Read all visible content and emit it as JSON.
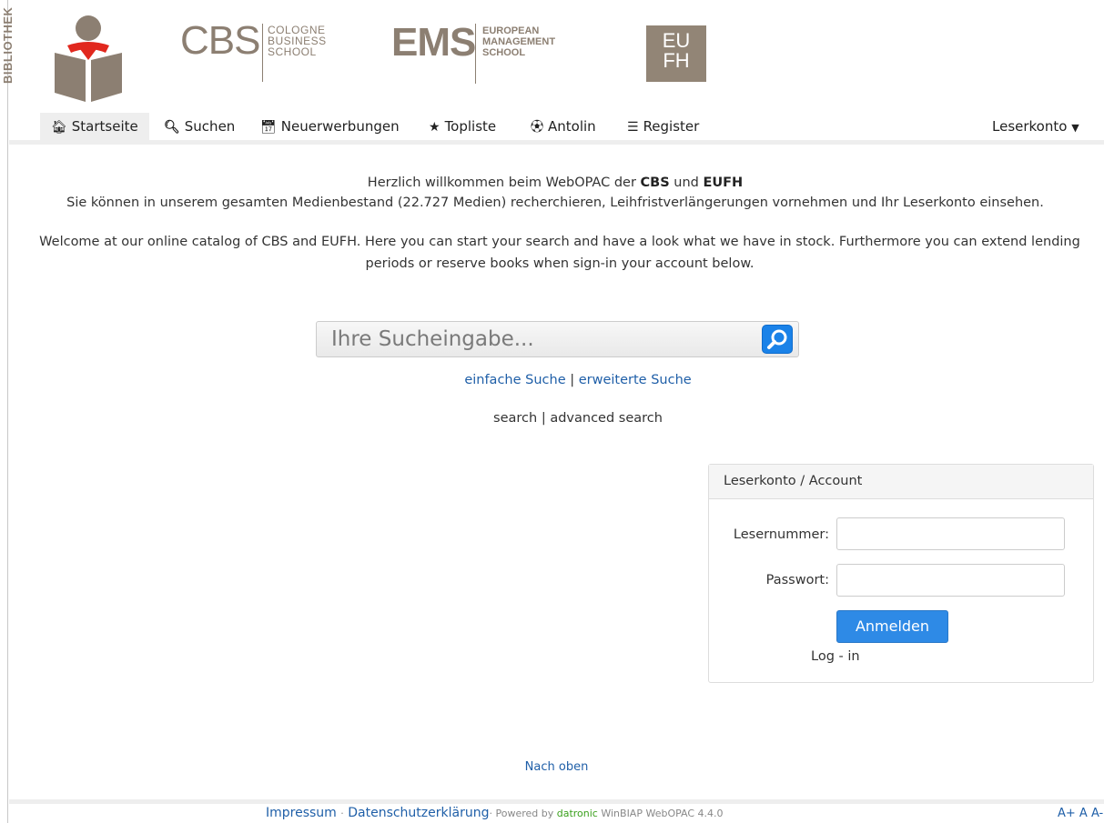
{
  "header": {
    "side_label": "BIBLIOTHEK",
    "cbs": {
      "big": "CBS",
      "line1": "COLOGNE",
      "line2": "BUSINESS",
      "line3": "SCHOOL"
    },
    "ems": {
      "big": "EMS",
      "line1": "EUROPEAN",
      "line2": "MANAGEMENT",
      "line3": "SCHOOL"
    },
    "eufh": {
      "line1": "EU",
      "line2": "FH"
    }
  },
  "nav": {
    "items": [
      {
        "label": "Startseite",
        "icon": "home-icon"
      },
      {
        "label": "Suchen",
        "icon": "search-icon"
      },
      {
        "label": "Neuerwerbungen",
        "icon": "calendar-icon"
      },
      {
        "label": "Topliste",
        "icon": "star-icon"
      },
      {
        "label": "Antolin",
        "icon": "soccer-ball-icon"
      },
      {
        "label": "Register",
        "icon": "list-icon"
      }
    ],
    "account": "Leserkonto",
    "active": "Startseite"
  },
  "welcome": {
    "line1_pre": "Herzlich willkommen beim WebOPAC der ",
    "line1_cbs": "CBS",
    "line1_mid": " und ",
    "line1_eufh": "EUFH",
    "line2": "Sie können in unserem gesamten Medienbestand (22.727 Medien) recherchieren, Leihfristverlängerungen vornehmen und Ihr Leserkonto einsehen.",
    "english": "Welcome at our online catalog of  CBS and EUFH. Here you can start your search and have a look what we have in stock. Furthermore you can extend lending periods or reserve books when sign-in your account below."
  },
  "search": {
    "placeholder": "Ihre Sucheingabe...",
    "simple": "einfache Suche",
    "advanced": "erweiterte Suche",
    "separator": "|",
    "simple_en": "search",
    "advanced_en": "advanced search"
  },
  "login": {
    "title": "Leserkonto / Account",
    "reader_label": "Lesernummer:",
    "password_label": "Passwort:",
    "button": "Anmelden",
    "login_en": "Log - in"
  },
  "footer": {
    "top_link": "Nach oben",
    "impressum": "Impressum",
    "dot": "·",
    "privacy": "Datenschutzerklärung",
    "powered_pre": "· Powered by ",
    "brand": "datronic",
    "powered_post": " WinBIAP WebOPAC 4.4.0",
    "font_controls": "A+ A A-"
  },
  "colors": {
    "brand_gray": "#8c7f72",
    "reader_red": "#e1281e",
    "link_blue": "#1f5fa8",
    "button_blue": "#2e8ae6"
  }
}
